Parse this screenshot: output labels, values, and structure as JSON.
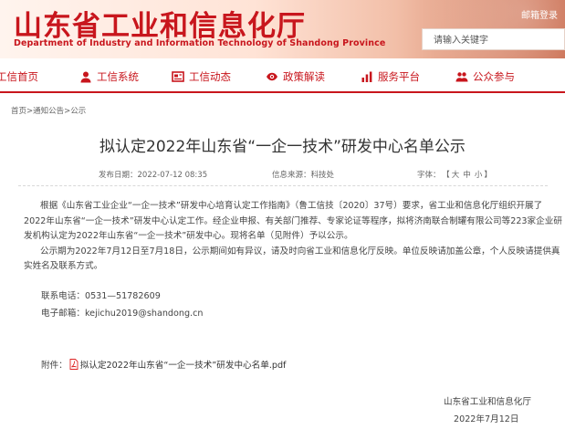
{
  "header": {
    "title": "山东省工业和信息化厅",
    "subtitle": "Department of Industry and Information Technology of Shandong Province",
    "mail_link": "邮箱登录",
    "search_placeholder": "请输入关键字"
  },
  "nav": {
    "items": [
      {
        "label": "工信首页",
        "icon": "home-icon"
      },
      {
        "label": "工信系统",
        "icon": "user-icon"
      },
      {
        "label": "工信动态",
        "icon": "news-icon"
      },
      {
        "label": "政策解读",
        "icon": "eye-icon"
      },
      {
        "label": "服务平台",
        "icon": "bars-icon"
      },
      {
        "label": "公众参与",
        "icon": "people-icon"
      }
    ]
  },
  "breadcrumb": {
    "home": "首页",
    "sep1": ">",
    "notice": "通知公告",
    "sep2": ">",
    "current": "公示"
  },
  "article": {
    "title": "拟认定2022年山东省“一企一技术”研发中心名单公示",
    "publish_label": "发布日期：",
    "publish_date": "2022-07-12 08:35",
    "source_label": "信息来源：",
    "source": "科技处",
    "font_label": "字体：",
    "font_open": "【",
    "font_large": "大",
    "font_medium": "中",
    "font_small": "小",
    "font_close": "】",
    "para1": "根据《山东省工业企业“一企一技术”研发中心培育认定工作指南》（鲁工信技〔2020〕37号）要求，省工业和信息化厅组织开展了2022年山东省“一企一技术”研发中心认定工作。经企业申报、有关部门推荐、专家论证等程序，拟将济南联合制罐有限公司等223家企业研发机构认定为2022年山东省“一企一技术”研发中心。现将名单（见附件）予以公示。",
    "para2": "公示期为2022年7月12日至7月18日，公示期间如有异议，请及时向省工业和信息化厅反映。单位反映请加盖公章，个人反映请提供真实姓名及联系方式。",
    "phone": "联系电话：0531—51782609",
    "email": "电子邮箱：kejichu2019@shandong.cn",
    "attachment_label": "附件：",
    "attachment_name": "拟认定2022年山东省“一企一技术”研发中心名单.pdf",
    "signature_org": "山东省工业和信息化厅",
    "signature_date": "2022年7月12日"
  },
  "colors": {
    "brand_red": "#c8161d"
  }
}
